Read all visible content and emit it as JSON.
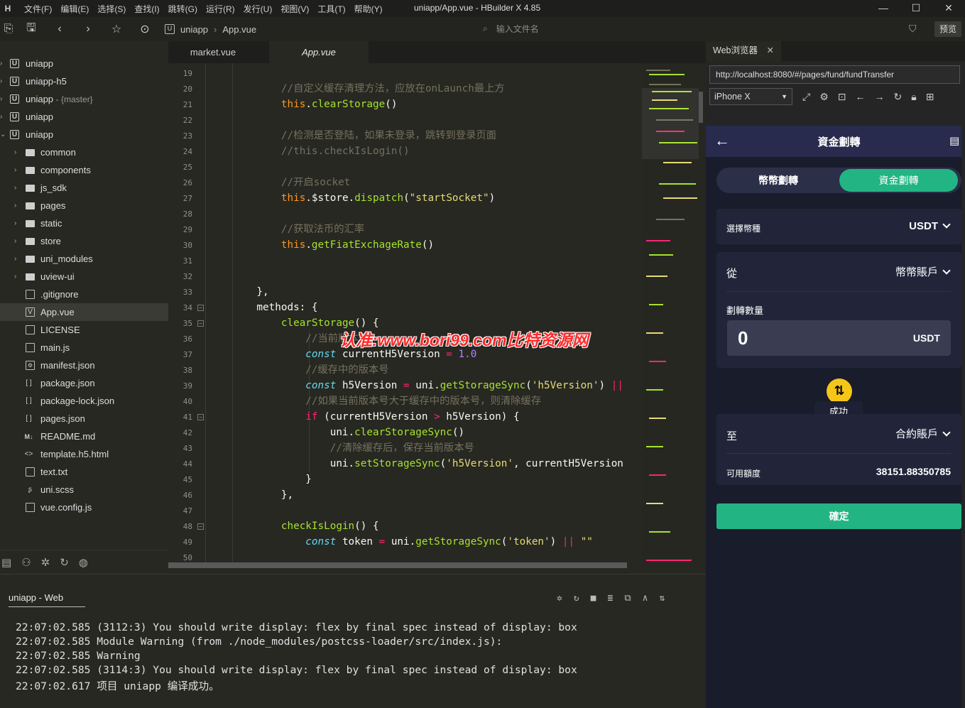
{
  "window": {
    "title": "uniapp/App.vue - HBuilder X 4.85",
    "menu": [
      "文件(F)",
      "编辑(E)",
      "选择(S)",
      "查找(I)",
      "跳转(G)",
      "运行(R)",
      "发行(U)",
      "视图(V)",
      "工具(T)",
      "帮助(Y)"
    ],
    "controls": [
      "—",
      "☐",
      "✕"
    ]
  },
  "toolbar": {
    "breadcrumb": [
      "uniapp",
      "App.vue"
    ],
    "search_placeholder": "输入文件名",
    "preview_label": "预览"
  },
  "sidebar": {
    "roots": [
      {
        "label": "uniapp",
        "branch": ""
      },
      {
        "label": "uniapp-h5",
        "branch": ""
      },
      {
        "label": "uniapp",
        "branch": "- {master}"
      },
      {
        "label": "uniapp",
        "branch": ""
      },
      {
        "label": "uniapp",
        "branch": ""
      }
    ],
    "folders": [
      "common",
      "components",
      "js_sdk",
      "pages",
      "static",
      "store",
      "uni_modules",
      "uview-ui"
    ],
    "files": [
      ".gitignore",
      "App.vue",
      "LICENSE",
      "main.js",
      "manifest.json",
      "package.json",
      "package-lock.json",
      "pages.json",
      "README.md",
      "template.h5.html",
      "text.txt",
      "uni.scss",
      "vue.config.js"
    ],
    "selected": "App.vue"
  },
  "editor_tabs": [
    {
      "label": "market.vue",
      "active": false
    },
    {
      "label": "App.vue",
      "active": true
    }
  ],
  "editor": {
    "line_numbers": [
      "19",
      "20",
      "21",
      "22",
      "23",
      "24",
      "25",
      "26",
      "27",
      "28",
      "29",
      "30",
      "31",
      "32",
      "33",
      "34",
      "35",
      "36",
      "37",
      "38",
      "39",
      "40",
      "41",
      "42",
      "43",
      "44",
      "45",
      "46",
      "47",
      "48",
      "49",
      "50"
    ],
    "folded_lines": [
      "34",
      "35",
      "41",
      "48"
    ]
  },
  "watermark": "认准:www.bori99.com比特资源网",
  "console": {
    "title": "uniapp - Web",
    "lines": [
      "22:07:02.585 (3112:3) You should write display: flex by final spec instead of display: box",
      "22:07:02.585 Module Warning (from ./node_modules/postcss-loader/src/index.js):",
      "22:07:02.585 Warning",
      "22:07:02.585 (3114:3) You should write display: flex by final spec instead of display: box",
      "22:07:02.617 项目 uniapp 编译成功。"
    ]
  },
  "browser": {
    "tab_label": "Web浏览器",
    "url": "http://localhost:8080/#/pages/fund/fundTransfer",
    "device": "iPhone X"
  },
  "app": {
    "title": "資金劃轉",
    "seg_left": "幣幣劃轉",
    "seg_right": "資金劃轉",
    "currency_label": "選擇幣種",
    "currency_value": "USDT",
    "from_label": "從",
    "from_value": "幣幣賬戶",
    "amount_label": "劃轉數量",
    "amount_value": "0",
    "amount_unit": "USDT",
    "toast": "成功",
    "to_label": "至",
    "to_value": "合約賬戶",
    "available_label": "可用額度",
    "available_value": "38151.88350785",
    "confirm_label": "確定",
    "accent": "#22b583",
    "swap_color": "#f5c518"
  }
}
